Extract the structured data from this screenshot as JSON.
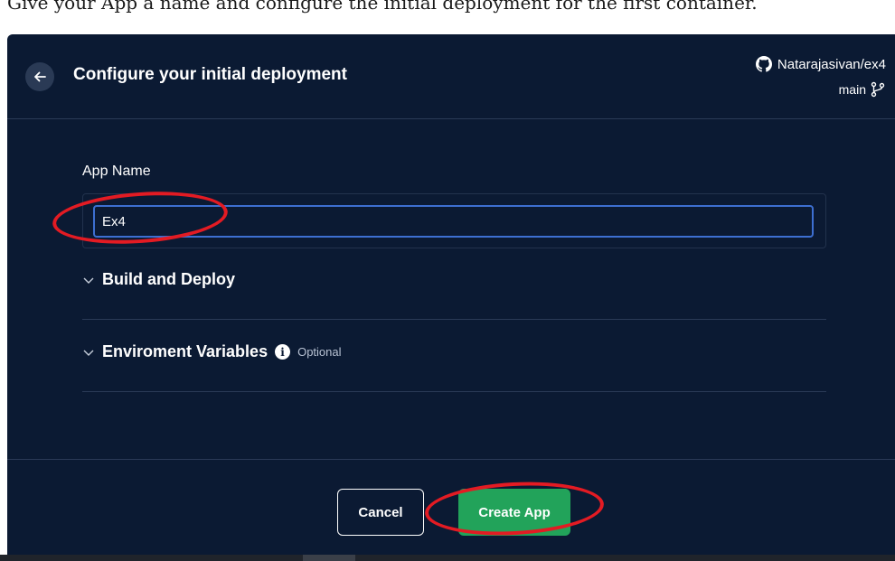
{
  "doc": {
    "caption": "Give your App a name and configure the initial deployment for the first container."
  },
  "dialog": {
    "title": "Configure your initial deployment",
    "repo": "Natarajasivan/ex4",
    "branch": "main"
  },
  "form": {
    "app_name_label": "App Name",
    "app_name_value": "Ex4",
    "build_deploy_label": "Build and Deploy",
    "env_vars_label": "Enviroment Variables",
    "env_vars_optional": "Optional"
  },
  "footer": {
    "cancel_label": "Cancel",
    "create_label": "Create App"
  },
  "colors": {
    "dialog_bg": "#0b1a33",
    "primary": "#22a35a",
    "focus": "#3d6fd1",
    "annotation": "#e31b23"
  },
  "icons": [
    "arrow-left-icon",
    "github-icon",
    "git-branch-icon",
    "chevron-down-icon",
    "info-icon"
  ]
}
